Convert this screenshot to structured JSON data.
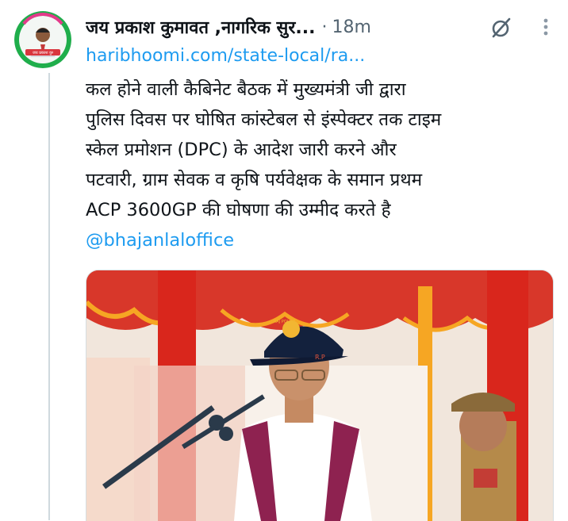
{
  "post": {
    "author": {
      "display_name": "जय प्रकाश कुमावत ,नागरिक सुर...",
      "avatar_caption": "जय प्रकाश कुमावत",
      "avatar_icon": "profile-photo"
    },
    "separator": "·",
    "timestamp": "18m",
    "link_text": "haribhoomi.com/state-local/ra...",
    "body_lines": [
      "कल होने वाली कैबिनेट बैठक में मुख्यमंत्री जी द्वारा",
      "पुलिस दिवस पर घोषित कांस्टेबल से इंस्पेक्टर तक टाइम",
      "स्केल प्रमोशन (DPC) के आदेश जारी करने और",
      "पटवारी, ग्राम सेवक व कृषि पर्यवेक्षक के समान प्रथम",
      "ACP 3600GP की घोषणा की उम्मीद करते है"
    ],
    "mention": "@bhajanlaloffice",
    "media": {
      "cap_text": "R.P",
      "badge_text": "RAJ POLICE"
    }
  },
  "icons": {
    "grok": "grok-slash-icon",
    "more": "more-vertical-icon"
  },
  "colors": {
    "link_blue": "#1d9bf0",
    "muted_gray": "#536471",
    "text": "#0f1419"
  }
}
